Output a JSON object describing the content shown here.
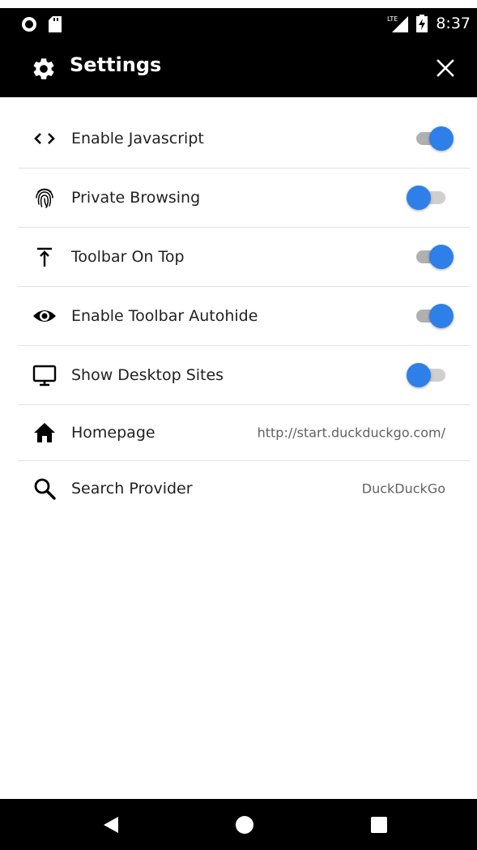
{
  "status_bar": {
    "time": "8:37",
    "icons": [
      "circle-notification-icon",
      "sd-card-icon",
      "lte-signal-icon",
      "battery-charging-icon"
    ]
  },
  "app_bar": {
    "title": "Settings",
    "left_icon": "gear-icon",
    "right_icon": "close-icon"
  },
  "settings": {
    "toggles": [
      {
        "label": "Enable Javascript",
        "icon": "code-icon",
        "on": true
      },
      {
        "label": "Private Browsing",
        "icon": "fingerprint-icon",
        "on": false
      },
      {
        "label": "Toolbar On Top",
        "icon": "vertical-align-top-icon",
        "on": true
      },
      {
        "label": "Enable Toolbar Autohide",
        "icon": "eye-icon",
        "on": true
      },
      {
        "label": "Show Desktop Sites",
        "icon": "desktop-icon",
        "on": false
      }
    ],
    "values": [
      {
        "label": "Homepage",
        "icon": "home-icon",
        "value": "http://start.duckduckgo.com/"
      },
      {
        "label": "Search Provider",
        "icon": "search-icon",
        "value": "DuckDuckGo"
      }
    ]
  },
  "nav_bar": {
    "icons": [
      "back-icon",
      "home-circle-icon",
      "recents-icon"
    ]
  },
  "colors": {
    "accent": "#2f7fe8",
    "bar_background": "#000000",
    "divider": "#e3e3e3"
  }
}
